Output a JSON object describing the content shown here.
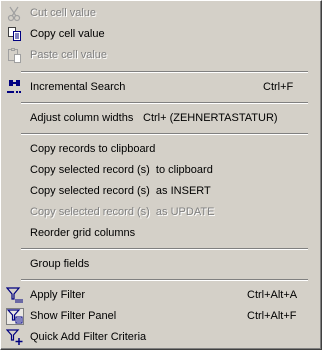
{
  "menu": {
    "cut": {
      "label": "Cut cell value",
      "icon": "scissors-icon",
      "disabled": true
    },
    "copy": {
      "label": "Copy cell value",
      "icon": "copy-icon",
      "disabled": false
    },
    "paste": {
      "label": "Paste cell value",
      "icon": "paste-icon",
      "disabled": true
    },
    "incremental_search": {
      "label": "Incremental Search",
      "shortcut": "Ctrl+F",
      "icon": "binoculars-search-icon"
    },
    "adjust_columns": {
      "label": "Adjust column widths",
      "shortcut": "Ctrl+ (ZEHNERTASTATUR)"
    },
    "copy_records": {
      "label": "Copy records to clipboard"
    },
    "copy_selected_clipboard": {
      "label": "Copy selected record (s)  to clipboard"
    },
    "copy_selected_insert": {
      "label": "Copy selected record (s)  as INSERT"
    },
    "copy_selected_update": {
      "label": "Copy selected record (s)  as UPDATE",
      "disabled": true
    },
    "reorder_columns": {
      "label": "Reorder grid columns"
    },
    "group_fields": {
      "label": "Group fields"
    },
    "apply_filter": {
      "label": "Apply Filter",
      "shortcut": "Ctrl+Alt+A",
      "icon": "filter-icon"
    },
    "show_filter_panel": {
      "label": "Show Filter Panel",
      "shortcut": "Ctrl+Alt+F",
      "icon": "filter-panel-icon",
      "checked": true
    },
    "quick_add_filter": {
      "label": "Quick Add Filter Criteria",
      "icon": "filter-add-icon"
    }
  },
  "colors": {
    "menu_bg": "#d4d0c8",
    "disabled_text": "#808080",
    "icon_blue": "#000080"
  }
}
